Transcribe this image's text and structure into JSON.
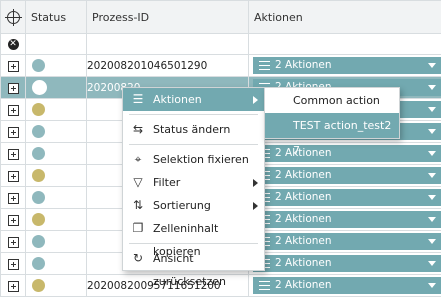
{
  "header": {
    "status": "Status",
    "prozess_id": "Prozess-ID",
    "aktionen": "Aktionen"
  },
  "colors": {
    "accent": "#72a9b0",
    "selected_row": "#8fb8bd",
    "status_teal": "#8fb8bd",
    "status_olive": "#c8b86b",
    "status_white": "#ffffff"
  },
  "rows": [
    {
      "status_color": "#8fb8bd",
      "prozess_id": "2020082010465012​90",
      "aktionen": "2 Aktionen"
    },
    {
      "status_color": "#ffffff",
      "prozess_id": "20200820…",
      "aktionen": "2 Aktionen",
      "selected": true
    },
    {
      "status_color": "#c8b86b",
      "prozess_id": "",
      "aktionen": "2 Aktionen"
    },
    {
      "status_color": "#8fb8bd",
      "prozess_id": "",
      "aktionen": "2 Aktionen"
    },
    {
      "status_color": "#8fb8bd",
      "prozess_id": "",
      "aktionen": "2 Aktionen"
    },
    {
      "status_color": "#c8b86b",
      "prozess_id": "",
      "aktionen": "2 Aktionen"
    },
    {
      "status_color": "#8fb8bd",
      "prozess_id": "",
      "aktionen": "2 Aktionen"
    },
    {
      "status_color": "#c8b86b",
      "prozess_id": "",
      "aktionen": "2 Aktionen"
    },
    {
      "status_color": "#8fb8bd",
      "prozess_id": "",
      "aktionen": "2 Aktionen"
    },
    {
      "status_color": "#8fb8bd",
      "prozess_id": "",
      "aktionen": "2 Aktionen"
    },
    {
      "status_color": "#c8b86b",
      "prozess_id": "20200820095711651200",
      "aktionen": "2 Aktionen"
    }
  ],
  "context_menu": {
    "items": [
      {
        "icon": "list-icon",
        "label": "Aktionen",
        "submenu": true,
        "active": true
      },
      {
        "icon": "status-change-icon",
        "label": "Status ändern"
      },
      {
        "icon": "crosshair-icon",
        "label": "Selektion fixieren"
      },
      {
        "icon": "filter-icon",
        "label": "Filter",
        "submenu": true
      },
      {
        "icon": "sort-icon",
        "label": "Sortierung",
        "submenu": true
      },
      {
        "icon": "copy-icon",
        "label": "Zelleninhalt kopieren"
      },
      {
        "icon": "reset-icon",
        "label": "Ansicht zurücksetzen"
      }
    ]
  },
  "submenu": {
    "items": [
      "Common action",
      "TEST action_test2 7"
    ]
  }
}
